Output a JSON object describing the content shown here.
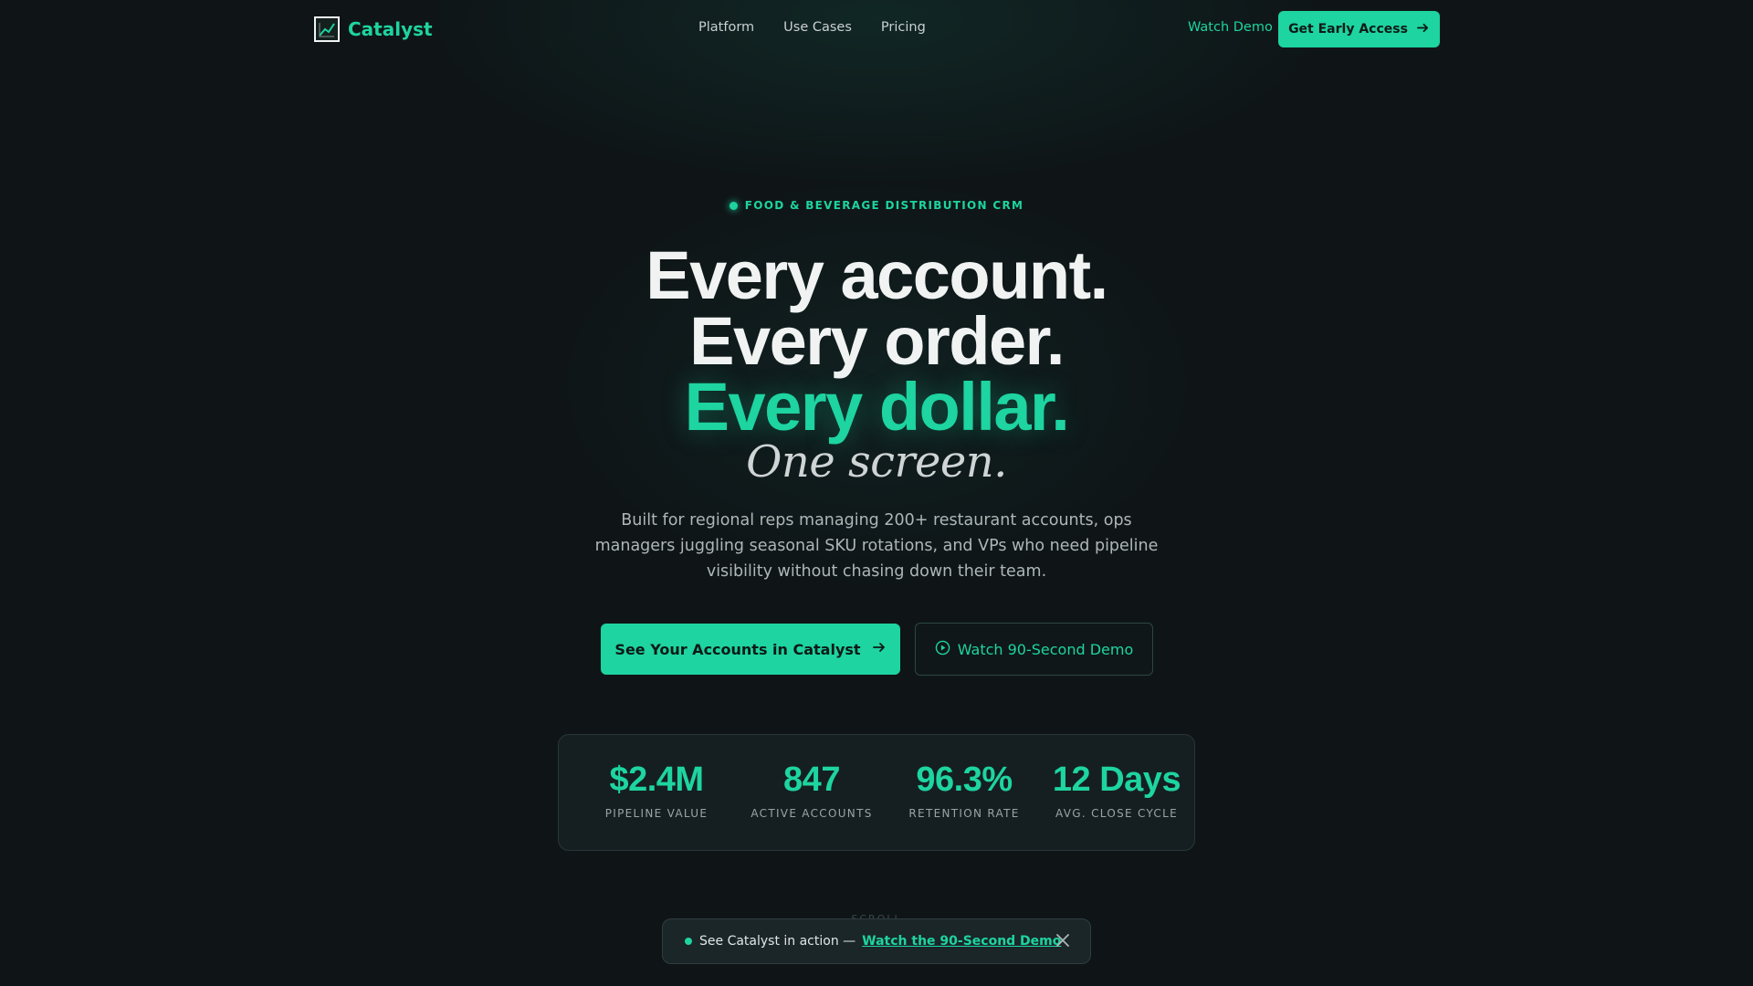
{
  "brand": {
    "name": "Catalyst",
    "logo_icon": "chart-logo-icon"
  },
  "nav": {
    "links": [
      "Platform",
      "Use Cases",
      "Pricing"
    ],
    "watch_demo": "Watch Demo",
    "cta": "Get Early Access"
  },
  "hero": {
    "eyebrow": "FOOD & BEVERAGE DISTRIBUTION CRM",
    "line1": "Every account.",
    "line2": "Every order.",
    "line3": "Every dollar.",
    "line4": "One screen.",
    "subtitle": "Built for regional reps managing 200+ restaurant accounts, ops managers juggling seasonal SKU rotations, and VPs who need pipeline visibility without chasing down their team.",
    "primary_cta": "See Your Accounts in Catalyst",
    "secondary_cta": "Watch 90-Second Demo"
  },
  "stats": [
    {
      "value": "$2.4M",
      "label": "PIPELINE VALUE"
    },
    {
      "value": "847",
      "label": "ACTIVE ACCOUNTS"
    },
    {
      "value": "96.3%",
      "label": "RETENTION RATE"
    },
    {
      "value": "12 Days",
      "label": "AVG. CLOSE CYCLE"
    }
  ],
  "scroll_hint": "SCROLL",
  "banner": {
    "text": "See Catalyst in action —",
    "link": "Watch the 90-Second Demo"
  },
  "colors": {
    "accent": "#1ed4a0",
    "background": "#0f1517"
  }
}
